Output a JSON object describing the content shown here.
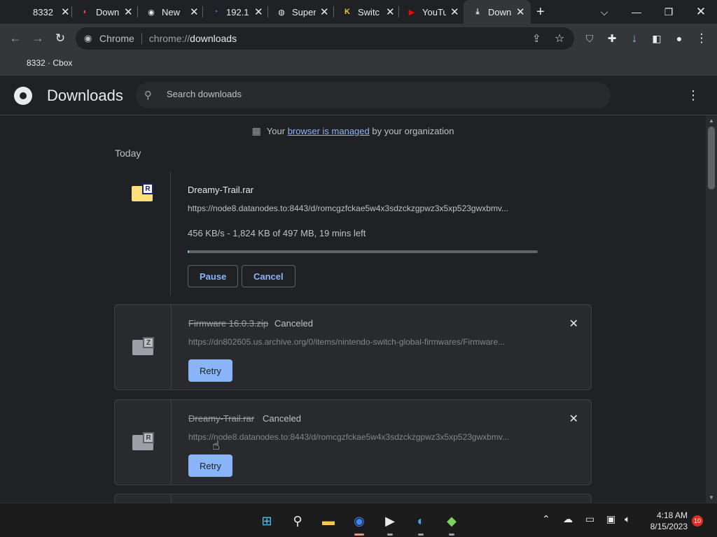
{
  "browser": {
    "tabs": [
      {
        "title": "8332",
        "icon": "cbox-icon"
      },
      {
        "title": "Down",
        "icon": "switch-icon",
        "favicon_color": "#e64a4a"
      },
      {
        "title": "New",
        "icon": "chrome-icon"
      },
      {
        "title": "192.1",
        "icon": "rss-icon",
        "favicon_color": "#4a7bd6"
      },
      {
        "title": "Super",
        "icon": "globe-icon"
      },
      {
        "title": "Switc",
        "icon": "k-icon",
        "favicon_color": "#f4c430"
      },
      {
        "title": "YouTu",
        "icon": "youtube-icon",
        "favicon_color": "#ff0000"
      },
      {
        "title": "Down",
        "icon": "download-icon",
        "active": true
      }
    ],
    "omnibox": {
      "chip": "Chrome",
      "url_scheme": "chrome://",
      "url_host": "downloads"
    },
    "bookmark": "8332 · Cbox"
  },
  "downloads_page": {
    "title": "Downloads",
    "search_placeholder": "Search downloads",
    "managed_prefix": "Your ",
    "managed_link": "browser is managed",
    "managed_suffix": " by your organization",
    "section": "Today",
    "items": [
      {
        "name": "Dreamy-Trail.rar",
        "url": "https://node8.datanodes.to:8443/d/romcgzfckae5w4x3sdzckzgpwz3x5xp523gwxbmv...",
        "progress_text": "456 KB/s - 1,824 KB of 497 MB, 19 mins left",
        "progress_fraction": 0.004,
        "pause_label": "Pause",
        "cancel_label": "Cancel"
      },
      {
        "name": "Firmware 16.0.3.zip",
        "status": "Canceled",
        "url": "https://dn802605.us.archive.org/0/items/nintendo-switch-global-firmwares/Firmware...",
        "retry_label": "Retry"
      },
      {
        "name": "Dreamy-Trail.rar",
        "status": "Canceled",
        "url": "https://node8.datanodes.to:8443/d/romcgzfckae5w4x3sdzckzgpwz3x5xp523gwxbmv...",
        "retry_label": "Retry"
      }
    ]
  },
  "taskbar": {
    "time": "4:18 AM",
    "date": "8/15/2023",
    "notifications": "10"
  }
}
